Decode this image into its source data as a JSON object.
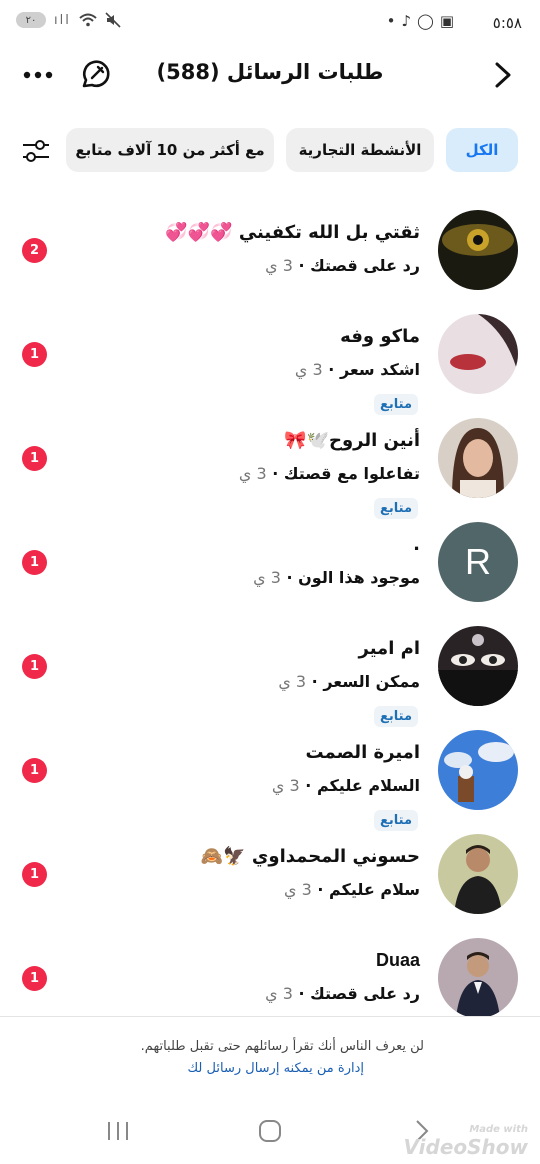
{
  "status_bar": {
    "time": "٥:٥٨",
    "battery": "٢٠",
    "icons": [
      "signal-icon",
      "wifi-icon",
      "mute-icon",
      "screen-record-icon",
      "whatsapp-icon",
      "tiktok-icon",
      "dot-icon"
    ]
  },
  "header": {
    "title": "طلبات الرسائل (588)"
  },
  "filters": {
    "chips": [
      {
        "label": "الكل",
        "active": true
      },
      {
        "label": "الأنشطة التجارية",
        "active": false
      },
      {
        "label": "مع أكثر من 10 آلاف متابع",
        "active": false
      }
    ]
  },
  "requests": [
    {
      "name": "ثقتي بل الله تكفيني 💞💞💞",
      "preview": "رد على قصتك",
      "time": "3 ي",
      "follower": "",
      "unread": "2",
      "avatar": "eye-photo"
    },
    {
      "name": "ماكو وفه",
      "preview": "اشكد سعر",
      "time": "3 ي",
      "follower": "متابع",
      "unread": "1",
      "avatar": "lips-photo"
    },
    {
      "name": "أنين الروح🕊️🎀",
      "preview": "تفاعلوا مع قصتك",
      "time": "3 ي",
      "follower": "متابع",
      "unread": "1",
      "avatar": "woman-photo"
    },
    {
      "name": ".",
      "preview": "موجود هذا الون",
      "time": "3 ي",
      "follower": "",
      "unread": "1",
      "avatar": "R"
    },
    {
      "name": "ام امير",
      "preview": "ممكن السعر",
      "time": "3 ي",
      "follower": "متابع",
      "unread": "1",
      "avatar": "veiled-eyes-photo"
    },
    {
      "name": "اميرة الصمت",
      "preview": "السلام عليكم",
      "time": "3 ي",
      "follower": "متابع",
      "unread": "1",
      "avatar": "sky-photo"
    },
    {
      "name": "حسوني المحمداوي 🦅🙈",
      "preview": "سلام عليكم",
      "time": "3 ي",
      "follower": "",
      "unread": "1",
      "avatar": "boy-photo"
    },
    {
      "name": "Duaa",
      "preview": "رد على قصتك",
      "time": "3 ي",
      "follower": "",
      "unread": "1",
      "avatar": "boy-suit-photo"
    }
  ],
  "footer": {
    "note": "لن يعرف الناس أنك تقرأ رسائلهم حتى تقبل طلباتهم.",
    "link": "إدارة من يمكنه إرسال رسائل لك"
  },
  "watermark": {
    "line1": "Made with",
    "line2": "VideoShow"
  },
  "colors": {
    "accent": "#1877f2",
    "badge": "#f02849",
    "chip_bg": "#efefef",
    "chip_active_bg": "#d9ecfb"
  }
}
